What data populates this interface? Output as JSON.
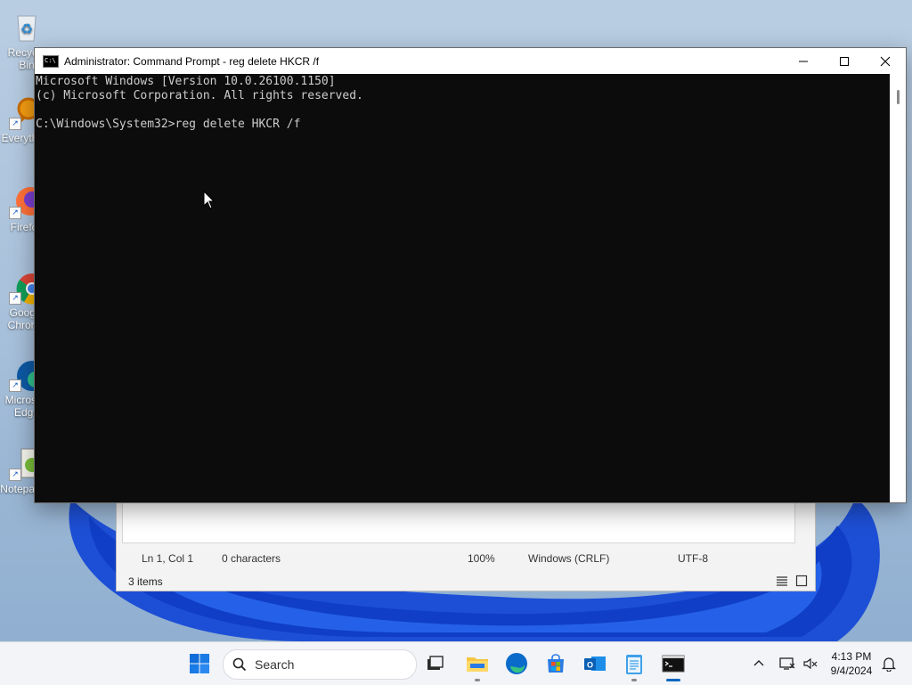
{
  "desktop": {
    "icons": [
      {
        "label": "Recycle Bin"
      },
      {
        "label": "Everything"
      },
      {
        "label": "Firefox"
      },
      {
        "label": "Google Chrome"
      },
      {
        "label": "Microsoft Edge"
      },
      {
        "label": "Notepad++"
      }
    ]
  },
  "background_window": {
    "notepad_status": {
      "position": "Ln 1, Col 1",
      "characters": "0 characters",
      "zoom": "100%",
      "line_endings": "Windows (CRLF)",
      "encoding": "UTF-8"
    },
    "explorer_status": {
      "items": "3 items"
    }
  },
  "cmd_window": {
    "title": "Administrator: Command Prompt - reg  delete HKCR /f",
    "lines": [
      "Microsoft Windows [Version 10.0.26100.1150]",
      "(c) Microsoft Corporation. All rights reserved.",
      "",
      "C:\\Windows\\System32>reg delete HKCR /f"
    ]
  },
  "taskbar": {
    "search_placeholder": "Search",
    "clock_time": "4:13 PM",
    "clock_date": "9/4/2024",
    "apps": [
      "start",
      "search",
      "task-view",
      "file-explorer",
      "edge",
      "store",
      "outlook",
      "notepad",
      "terminal"
    ]
  },
  "colors": {
    "cmd_bg": "#0c0c0c",
    "cmd_text": "#cccccc",
    "accent": "#0067c0"
  }
}
